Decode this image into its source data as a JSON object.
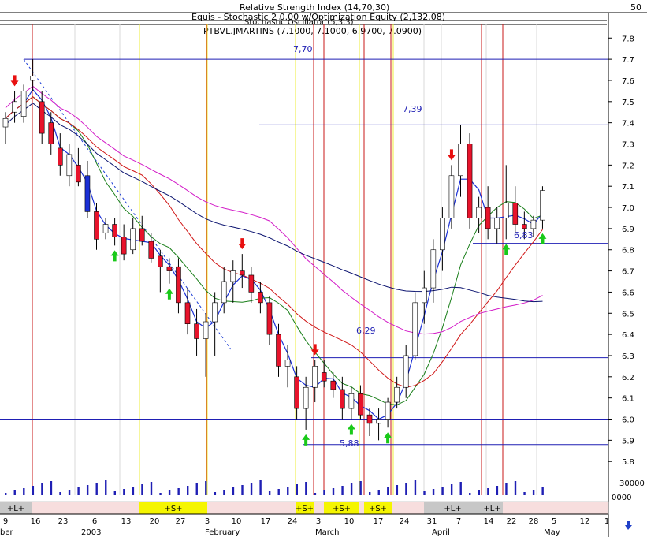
{
  "header": {
    "indicator_lines": [
      "Relative Strength Index (14,70,30)",
      "Equis - Stochastic Momentum Index (13,25,2)",
      "Stochastic Oscillator (5,3,3)"
    ],
    "equity_label": "Equis - Stochastic 2 0.00 w/Optimization Equity (2,132.08)",
    "symbol_label": "PTBVL.JMARTINS (7.1000, 7.1000, 6.9700, 7.0900)",
    "top_value": "50"
  },
  "annotations": {
    "high_left": "7,70",
    "high_right": "7,39",
    "mid": "6,29",
    "low": "5,88",
    "right_low": "6,83"
  },
  "colors": {
    "up_candle": "#ffffff",
    "down_candle": "#e8132b",
    "blue_candle": "#1a2fd6",
    "ma_fast": "#1a2fd6",
    "ma_green": "#1a7f1a",
    "ma_red": "#d01515",
    "ma_magenta": "#d31cc8",
    "ma_navy": "#0c1470",
    "buy_arrow": "#19c919",
    "sell_arrow": "#e81010",
    "long_band": "#c7c7c7",
    "short_band": "#f5f500"
  },
  "volume": {
    "scale_top": "30000",
    "scale_bottom": "0000"
  },
  "bands": [
    {
      "label": "+L+",
      "kind": "long"
    },
    {
      "label": "+S+",
      "kind": "short"
    },
    {
      "label": "+S+",
      "kind": "short"
    },
    {
      "label": "+S+",
      "kind": "short"
    },
    {
      "label": "+S+",
      "kind": "short"
    },
    {
      "label": "+L+",
      "kind": "long"
    },
    {
      "label": "+L+",
      "kind": "long"
    }
  ],
  "x_axis": {
    "day_labels": [
      "9",
      "16",
      "23",
      "6",
      "13",
      "20",
      "27",
      "3",
      "10",
      "17",
      "24",
      "3",
      "10",
      "17",
      "24",
      "31",
      "7",
      "14",
      "22",
      "28",
      "5",
      "12",
      "1"
    ],
    "month_labels": [
      "ber",
      "2003",
      "February",
      "March",
      "April",
      "May"
    ]
  },
  "chart_data": {
    "type": "candlestick",
    "title": "PTBVL.JMARTINS",
    "ylim": [
      5.73,
      7.95
    ],
    "y_ticks": [
      "7.8",
      "7.7",
      "7.6",
      "7.5",
      "7.4",
      "7.3",
      "7.2",
      "7.1",
      "7.0",
      "6.9",
      "6.8",
      "6.7",
      "6.6",
      "6.5",
      "6.4",
      "6.3",
      "6.2",
      "6.1",
      "6.0",
      "5.9",
      "5.8"
    ],
    "horizontal_levels": [
      7.7,
      7.39,
      6.29,
      6.0,
      5.88,
      6.83
    ],
    "candles": [
      {
        "o": 7.38,
        "h": 7.45,
        "l": 7.3,
        "c": 7.42
      },
      {
        "o": 7.45,
        "h": 7.55,
        "l": 7.4,
        "c": 7.5
      },
      {
        "o": 7.43,
        "h": 7.58,
        "l": 7.4,
        "c": 7.55
      },
      {
        "o": 7.6,
        "h": 7.7,
        "l": 7.55,
        "c": 7.62
      },
      {
        "o": 7.5,
        "h": 7.55,
        "l": 7.3,
        "c": 7.35
      },
      {
        "o": 7.4,
        "h": 7.45,
        "l": 7.25,
        "c": 7.3
      },
      {
        "o": 7.28,
        "h": 7.35,
        "l": 7.15,
        "c": 7.2
      },
      {
        "o": 7.15,
        "h": 7.3,
        "l": 7.1,
        "c": 7.25
      },
      {
        "o": 7.2,
        "h": 7.28,
        "l": 7.1,
        "c": 7.12
      },
      {
        "o": 7.15,
        "h": 7.22,
        "l": 6.95,
        "c": 6.98
      },
      {
        "o": 6.98,
        "h": 7.02,
        "l": 6.8,
        "c": 6.85
      },
      {
        "o": 6.88,
        "h": 6.95,
        "l": 6.85,
        "c": 6.92
      },
      {
        "o": 6.92,
        "h": 6.95,
        "l": 6.82,
        "c": 6.86
      },
      {
        "o": 6.86,
        "h": 6.92,
        "l": 6.75,
        "c": 6.78
      },
      {
        "o": 6.8,
        "h": 6.95,
        "l": 6.78,
        "c": 6.9
      },
      {
        "o": 6.9,
        "h": 6.96,
        "l": 6.82,
        "c": 6.84
      },
      {
        "o": 6.84,
        "h": 6.88,
        "l": 6.74,
        "c": 6.76
      },
      {
        "o": 6.77,
        "h": 6.8,
        "l": 6.6,
        "c": 6.72
      },
      {
        "o": 6.72,
        "h": 6.76,
        "l": 6.64,
        "c": 6.7
      },
      {
        "o": 6.72,
        "h": 6.76,
        "l": 6.5,
        "c": 6.55
      },
      {
        "o": 6.55,
        "h": 6.62,
        "l": 6.4,
        "c": 6.45
      },
      {
        "o": 6.45,
        "h": 6.52,
        "l": 6.3,
        "c": 6.38
      },
      {
        "o": 6.38,
        "h": 6.5,
        "l": 6.2,
        "c": 6.46
      },
      {
        "o": 6.46,
        "h": 6.6,
        "l": 6.3,
        "c": 6.55
      },
      {
        "o": 6.55,
        "h": 6.72,
        "l": 6.5,
        "c": 6.65
      },
      {
        "o": 6.65,
        "h": 6.75,
        "l": 6.55,
        "c": 6.7
      },
      {
        "o": 6.7,
        "h": 6.78,
        "l": 6.62,
        "c": 6.68
      },
      {
        "o": 6.68,
        "h": 6.72,
        "l": 6.55,
        "c": 6.6
      },
      {
        "o": 6.6,
        "h": 6.65,
        "l": 6.5,
        "c": 6.55
      },
      {
        "o": 6.55,
        "h": 6.58,
        "l": 6.35,
        "c": 6.4
      },
      {
        "o": 6.4,
        "h": 6.45,
        "l": 6.2,
        "c": 6.25
      },
      {
        "o": 6.25,
        "h": 6.35,
        "l": 6.15,
        "c": 6.28
      },
      {
        "o": 6.2,
        "h": 6.25,
        "l": 6.0,
        "c": 6.05
      },
      {
        "o": 6.05,
        "h": 6.2,
        "l": 5.95,
        "c": 6.15
      },
      {
        "o": 6.15,
        "h": 6.28,
        "l": 6.08,
        "c": 6.25
      },
      {
        "o": 6.22,
        "h": 6.28,
        "l": 6.15,
        "c": 6.18
      },
      {
        "o": 6.18,
        "h": 6.22,
        "l": 6.1,
        "c": 6.14
      },
      {
        "o": 6.14,
        "h": 6.2,
        "l": 6.0,
        "c": 6.05
      },
      {
        "o": 6.05,
        "h": 6.15,
        "l": 6.0,
        "c": 6.12
      },
      {
        "o": 6.12,
        "h": 6.16,
        "l": 6.0,
        "c": 6.02
      },
      {
        "o": 6.02,
        "h": 6.05,
        "l": 5.92,
        "c": 5.98
      },
      {
        "o": 5.98,
        "h": 6.05,
        "l": 5.9,
        "c": 6.0
      },
      {
        "o": 6.0,
        "h": 6.1,
        "l": 5.96,
        "c": 6.08
      },
      {
        "o": 6.08,
        "h": 6.2,
        "l": 6.05,
        "c": 6.15
      },
      {
        "o": 6.15,
        "h": 6.35,
        "l": 6.1,
        "c": 6.3
      },
      {
        "o": 6.3,
        "h": 6.6,
        "l": 6.28,
        "c": 6.55
      },
      {
        "o": 6.55,
        "h": 6.7,
        "l": 6.45,
        "c": 6.62
      },
      {
        "o": 6.62,
        "h": 6.85,
        "l": 6.55,
        "c": 6.8
      },
      {
        "o": 6.8,
        "h": 7.0,
        "l": 6.7,
        "c": 6.95
      },
      {
        "o": 6.95,
        "h": 7.2,
        "l": 6.9,
        "c": 7.15
      },
      {
        "o": 7.15,
        "h": 7.39,
        "l": 7.05,
        "c": 7.3
      },
      {
        "o": 7.3,
        "h": 7.35,
        "l": 6.9,
        "c": 6.95
      },
      {
        "o": 6.95,
        "h": 7.05,
        "l": 6.88,
        "c": 7.0
      },
      {
        "o": 7.0,
        "h": 7.1,
        "l": 6.85,
        "c": 6.9
      },
      {
        "o": 6.9,
        "h": 7.0,
        "l": 6.83,
        "c": 6.95
      },
      {
        "o": 6.95,
        "h": 7.2,
        "l": 6.85,
        "c": 7.02
      },
      {
        "o": 7.02,
        "h": 7.1,
        "l": 6.88,
        "c": 6.92
      },
      {
        "o": 6.92,
        "h": 6.98,
        "l": 6.85,
        "c": 6.9
      },
      {
        "o": 6.9,
        "h": 6.96,
        "l": 6.86,
        "c": 6.94
      },
      {
        "o": 6.94,
        "h": 7.1,
        "l": 6.9,
        "c": 7.08
      }
    ],
    "buy_signals": [
      12,
      18,
      33,
      38,
      42,
      55,
      59
    ],
    "sell_signals": [
      1,
      26,
      34,
      49
    ]
  }
}
